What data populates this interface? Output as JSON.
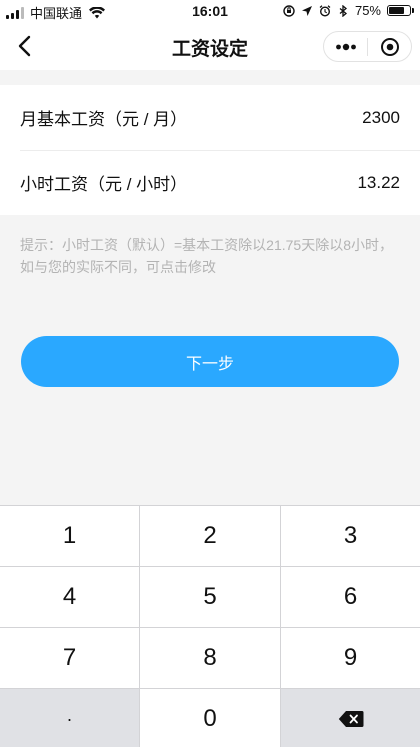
{
  "status_bar": {
    "carrier": "中国联通",
    "time": "16:01",
    "battery": "75%",
    "battery_level": 0.75
  },
  "nav": {
    "title": "工资设定"
  },
  "form": {
    "rows": [
      {
        "label": "月基本工资（元 / 月）",
        "value": "2300"
      },
      {
        "label": "小时工资（元 / 小时）",
        "value": "13.22"
      }
    ]
  },
  "hint": "提示：小时工资（默认）=基本工资除以21.75天除以8小时，如与您的实际不同，可点击修改",
  "next_button": "下一步",
  "keypad": {
    "keys": [
      "1",
      "2",
      "3",
      "4",
      "5",
      "6",
      "7",
      "8",
      "9",
      "·",
      "0"
    ]
  },
  "colors": {
    "accent": "#2aa8ff",
    "hint": "#b3b3b3",
    "background": "#f4f4f4"
  }
}
